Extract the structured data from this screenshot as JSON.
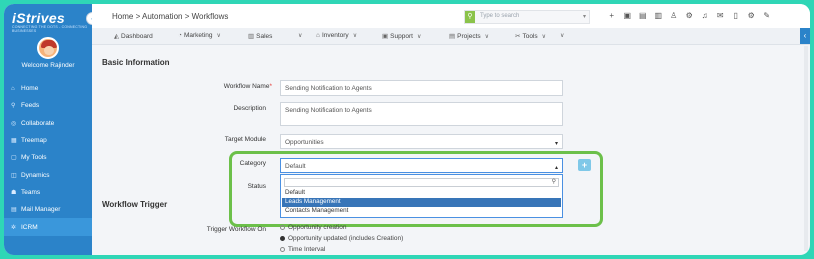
{
  "app": {
    "logo": "iStrives",
    "logo_sub": "CONNECTING THE DOTS - CONNECTING BUSINESSES",
    "welcome": "Welcome Rajinder"
  },
  "sidebar": {
    "items": [
      {
        "label": "Home",
        "icon": "home-icon",
        "symbol": "⌂"
      },
      {
        "label": "Feeds",
        "icon": "feeds-icon",
        "symbol": "⚲"
      },
      {
        "label": "Collaborate",
        "icon": "collaborate-icon",
        "symbol": "◎"
      },
      {
        "label": "Treemap",
        "icon": "treemap-icon",
        "symbol": "▦"
      },
      {
        "label": "My Tools",
        "icon": "tools-icon",
        "symbol": "▢"
      },
      {
        "label": "Dynamics",
        "icon": "dynamics-icon",
        "symbol": "◫"
      },
      {
        "label": "Teams",
        "icon": "teams-icon",
        "symbol": "☗"
      },
      {
        "label": "Mail Manager",
        "icon": "mail-icon",
        "symbol": "▤"
      },
      {
        "label": "ICRM",
        "icon": "icrm-icon",
        "symbol": "✲"
      }
    ]
  },
  "header": {
    "breadcrumb": "Home > Automation > Workflows",
    "search_placeholder": "Type to search"
  },
  "menubar": {
    "items": [
      {
        "label": "Dashboard"
      },
      {
        "label": "Marketing"
      },
      {
        "label": "Sales"
      },
      {
        "label": ""
      },
      {
        "label": "Inventory"
      },
      {
        "label": "Support"
      },
      {
        "label": "Projects"
      },
      {
        "label": "Tools"
      },
      {
        "label": ""
      }
    ]
  },
  "form": {
    "section_basic": "Basic Information",
    "workflow_name_label": "Workflow Name",
    "workflow_name_value": "Sending Notification to Agents",
    "description_label": "Description",
    "description_value": "Sending Notification to Agents",
    "target_module_label": "Target Module",
    "target_module_value": "Opportunities",
    "category_label": "Category",
    "category_value": "Default",
    "status_label": "Status",
    "category_options": [
      "Default",
      "Leads Management",
      "Contacts Management"
    ],
    "selected_option": "Leads Management",
    "section_trigger": "Workflow Trigger",
    "trigger_label": "Trigger Workflow On",
    "trigger_options": [
      "Opportunity creation",
      "Opportunity updated (includes Creation)",
      "Time Interval"
    ],
    "trigger_selected": "Opportunity updated (includes Creation)"
  },
  "colors": {
    "sidebar": "#2b83c9",
    "highlight": "#6cc04a",
    "background": "#2fd6b6",
    "selected_option": "#3875b8"
  }
}
